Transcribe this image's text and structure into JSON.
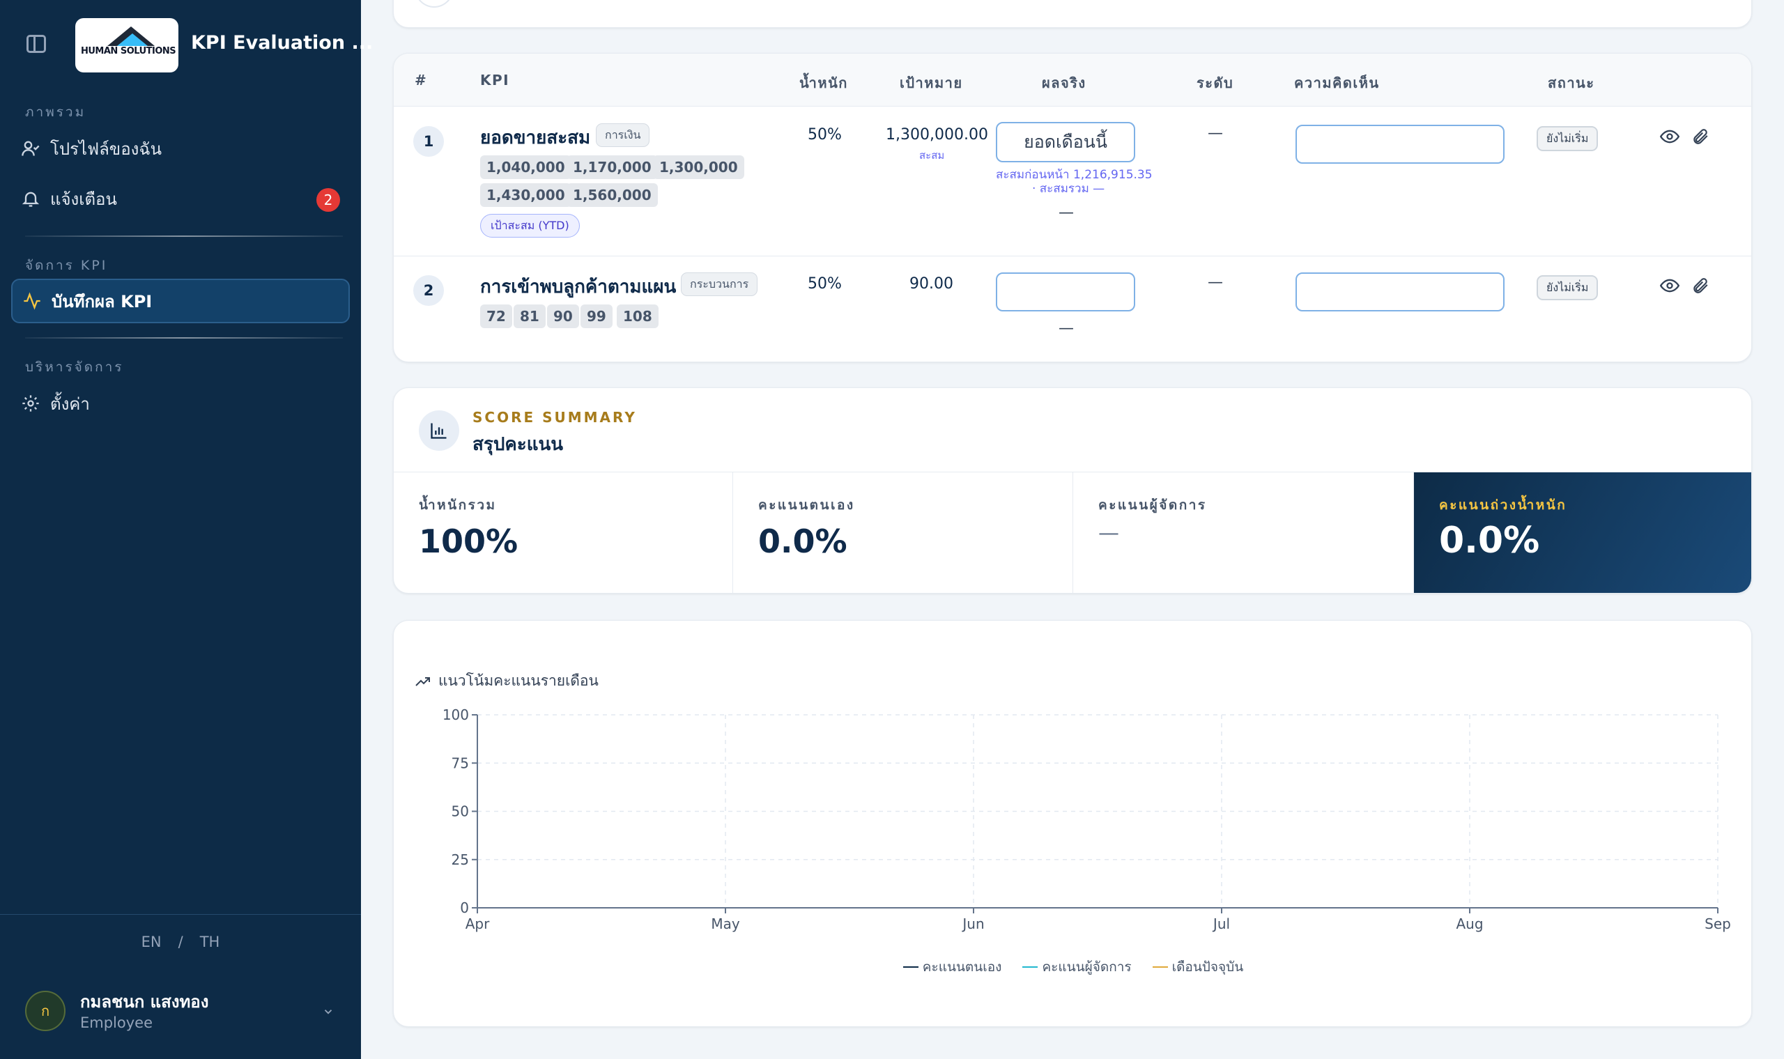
{
  "sidebar": {
    "app_title": "KPI Evaluation ...",
    "logo_text": "HUMAN SOLUTIONS",
    "sections": {
      "overview": "ภาพรวม",
      "manage_kpi": "จัดการ KPI",
      "admin": "บริหารจัดการ"
    },
    "items": {
      "profile": "โปรไฟล์ของฉัน",
      "notifications": "แจ้งเตือน",
      "notifications_count": "2",
      "record_kpi": "บันทึกผล KPI",
      "settings": "ตั้งค่า"
    },
    "lang": {
      "en": "EN",
      "sep": "/",
      "th": "TH"
    },
    "user": {
      "initial": "ก",
      "name": "กมลชนก แสงทอง",
      "role": "Employee"
    }
  },
  "kpi_table": {
    "headers": {
      "num": "#",
      "kpi": "KPI",
      "weight": "น้ำหนัก",
      "target": "เป้าหมาย",
      "actual": "ผลจริง",
      "level": "ระดับ",
      "comment": "ความคิดเห็น",
      "status": "สถานะ"
    },
    "rows": [
      {
        "num": "1",
        "name": "ยอดขายสะสม",
        "tag": "การเงิน",
        "chips": [
          "1,040,000",
          "1,170,000",
          "1,300,000",
          "1,430,000",
          "1,560,000"
        ],
        "ytd_badge": "เป้าสะสม (YTD)",
        "weight": "50%",
        "target": "1,300,000.00",
        "target_sub": "สะสม",
        "actual_placeholder": "ยอดเดือนนี้",
        "actual_note1": "สะสมก่อนหน้า 1,216,915.35",
        "actual_note2": "· สะสมรวม —",
        "actual_dash": "—",
        "level": "—",
        "status": "ยังไม่เริ่ม"
      },
      {
        "num": "2",
        "name": "การเข้าพบลูกค้าตามแผน",
        "tag": "กระบวนการ",
        "chips": [
          "72",
          "81",
          "90",
          "99",
          "108"
        ],
        "weight": "50%",
        "target": "90.00",
        "actual_dash": "—",
        "level": "—",
        "status": "ยังไม่เริ่ม"
      }
    ]
  },
  "summary": {
    "eyebrow": "SCORE SUMMARY",
    "title": "สรุปคะแนน",
    "cells": [
      {
        "label": "น้ำหนักรวม",
        "value": "100%"
      },
      {
        "label": "คะแนนตนเอง",
        "value": "0.0%"
      },
      {
        "label": "คะแนนผู้จัดการ",
        "value": "—"
      },
      {
        "label": "คะแนนถ่วงน้ำหนัก",
        "value": "0.0%"
      }
    ]
  },
  "chart_data": {
    "type": "line",
    "title": "แนวโน้มคะแนนรายเดือน",
    "categories": [
      "Apr",
      "May",
      "Jun",
      "Jul",
      "Aug",
      "Sep"
    ],
    "yticks": [
      0,
      25,
      50,
      75,
      100
    ],
    "ylim": [
      0,
      100
    ],
    "grid": true,
    "series": [
      {
        "name": "คะแนนตนเอง",
        "color": "#0d2b47",
        "values": []
      },
      {
        "name": "คะแนนผู้จัดการ",
        "color": "#22b8cf",
        "values": []
      },
      {
        "name": "เดือนปัจจุบัน",
        "color": "#e0a93b",
        "values": []
      }
    ],
    "legend_position": "bottom"
  }
}
